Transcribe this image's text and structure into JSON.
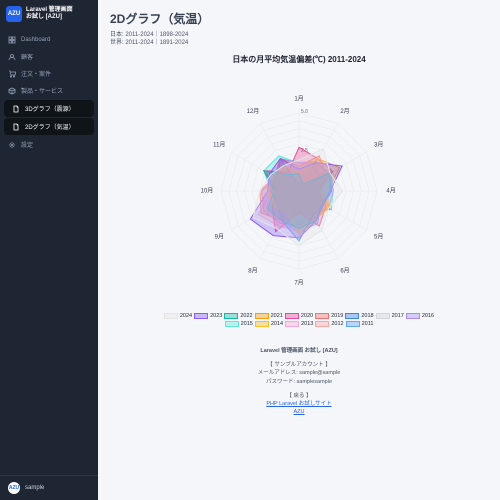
{
  "brand": {
    "logo": "AZU",
    "line1": "Laravel 管理画面",
    "line2": "お試し [AZU]"
  },
  "nav": [
    {
      "icon": "dashboard",
      "label": "Dashboard"
    },
    {
      "icon": "users",
      "label": "顧客"
    },
    {
      "icon": "cart",
      "label": "注文・案件"
    },
    {
      "icon": "box",
      "label": "製品・サービス"
    },
    {
      "icon": "doc",
      "label": "3Dグラフ（震源）",
      "active": true
    },
    {
      "icon": "doc",
      "label": "2Dグラフ（気温）",
      "active": true
    },
    {
      "icon": "gear",
      "label": "設定"
    }
  ],
  "user": {
    "initials": "AZU",
    "name": "sample"
  },
  "page": {
    "title": "2Dグラフ（気温）",
    "meta1": "日本: 2011-2024｜1898-2024",
    "meta2": "世界: 2011-2024｜1891-2024"
  },
  "chart_data": {
    "type": "radar",
    "title": "日本の月平均気温偏差(℃) 2011-2024",
    "categories": [
      "1月",
      "2月",
      "3月",
      "4月",
      "5月",
      "6月",
      "7月",
      "8月",
      "9月",
      "10月",
      "11月",
      "12月"
    ],
    "radial_ticks": [
      2.5,
      5.0
    ],
    "series": [
      {
        "name": "2024",
        "color": "#e5e5e5",
        "values": [
          2.0,
          3.1,
          2.3,
          2.8,
          2.2,
          2.9,
          3.5,
          2.8,
          3.4,
          2.5,
          2.1,
          1.9
        ]
      },
      {
        "name": "2023",
        "color": "#8b5cf6",
        "values": [
          1.4,
          2.1,
          3.2,
          2.0,
          1.8,
          2.2,
          3.0,
          3.3,
          3.6,
          2.0,
          2.2,
          2.4
        ]
      },
      {
        "name": "2022",
        "color": "#14b8a6",
        "values": [
          1.1,
          0.5,
          2.4,
          2.0,
          1.7,
          2.2,
          2.4,
          2.2,
          2.3,
          1.6,
          2.6,
          1.2
        ]
      },
      {
        "name": "2021",
        "color": "#f59e0b",
        "values": [
          1.2,
          2.4,
          3.0,
          1.8,
          2.2,
          2.1,
          2.8,
          1.6,
          1.9,
          1.9,
          1.9,
          1.8
        ]
      },
      {
        "name": "2020",
        "color": "#ec4899",
        "values": [
          2.8,
          2.4,
          2.5,
          1.2,
          2.0,
          2.6,
          1.4,
          3.0,
          2.0,
          1.4,
          2.6,
          1.4
        ]
      },
      {
        "name": "2019",
        "color": "#f87171",
        "values": [
          1.6,
          2.6,
          2.0,
          1.4,
          2.3,
          1.7,
          1.4,
          2.2,
          2.8,
          2.5,
          1.8,
          2.4
        ]
      },
      {
        "name": "2018",
        "color": "#3b82f6",
        "values": [
          0.4,
          0.2,
          2.2,
          2.1,
          1.8,
          1.8,
          3.2,
          2.2,
          1.6,
          1.8,
          1.8,
          2.4
        ]
      },
      {
        "name": "2017",
        "color": "#d1d5db",
        "values": [
          1.4,
          1.6,
          1.4,
          1.8,
          2.1,
          1.5,
          2.8,
          1.4,
          1.6,
          1.4,
          1.0,
          0.8
        ]
      },
      {
        "name": "2016",
        "color": "#a78bfa",
        "values": [
          1.8,
          2.2,
          2.2,
          2.2,
          2.2,
          2.0,
          2.2,
          2.4,
          2.6,
          2.4,
          1.6,
          2.4
        ]
      },
      {
        "name": "2015",
        "color": "#5eead4",
        "values": [
          1.8,
          2.0,
          2.4,
          2.2,
          2.4,
          1.4,
          2.2,
          2.0,
          1.4,
          1.8,
          2.6,
          2.6
        ]
      },
      {
        "name": "2014",
        "color": "#fbbf24",
        "values": [
          1.2,
          1.4,
          2.0,
          1.6,
          2.0,
          2.0,
          2.2,
          1.4,
          1.4,
          1.8,
          1.8,
          1.0
        ]
      },
      {
        "name": "2013",
        "color": "#f9a8d4",
        "values": [
          0.4,
          1.2,
          2.2,
          1.4,
          1.8,
          2.2,
          2.6,
          2.6,
          2.4,
          2.4,
          1.8,
          1.6
        ]
      },
      {
        "name": "2012",
        "color": "#fca5a5",
        "values": [
          0.6,
          0.2,
          1.6,
          1.6,
          1.8,
          1.8,
          2.4,
          2.6,
          3.0,
          1.8,
          1.2,
          0.6
        ]
      },
      {
        "name": "2011",
        "color": "#60a5fa",
        "values": [
          0.2,
          2.2,
          1.2,
          1.4,
          1.6,
          2.4,
          2.6,
          2.2,
          2.4,
          1.8,
          2.4,
          1.2
        ]
      }
    ]
  },
  "footer": {
    "title": "Laravel 管理画面 お試し [AZU]",
    "acct_hdr": "【 サンプルアカウント 】",
    "acct_email": "メールアドレス: sample@sample",
    "acct_pw": "パスワード: samplesample",
    "back_hdr": "【 戻る 】",
    "link1": "PHP Laravel お試しサイト",
    "link2": "AZU"
  }
}
